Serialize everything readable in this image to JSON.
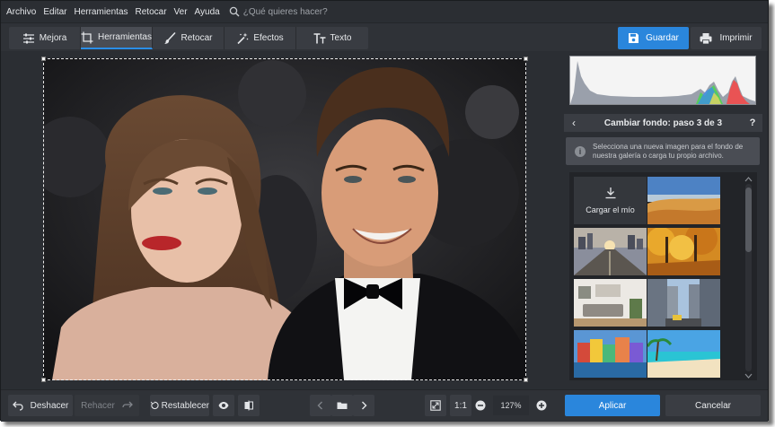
{
  "menu": {
    "items": [
      "Archivo",
      "Editar",
      "Herramientas",
      "Retocar",
      "Ver",
      "Ayuda"
    ],
    "search_placeholder": "¿Qué quieres hacer?"
  },
  "tabs": [
    {
      "label": "Mejora",
      "icon": "sliders-icon",
      "active": false
    },
    {
      "label": "Herramientas",
      "icon": "crop-icon",
      "active": true
    },
    {
      "label": "Retocar",
      "icon": "brush-icon",
      "active": false
    },
    {
      "label": "Efectos",
      "icon": "magic-wand-icon",
      "active": false
    },
    {
      "label": "Texto",
      "icon": "text-icon",
      "active": false
    }
  ],
  "header_actions": {
    "save_label": "Guardar",
    "print_label": "Imprimir"
  },
  "panel": {
    "step_title": "Cambiar fondo: paso 3 de 3",
    "help": "?",
    "info_text": "Selecciona una nueva imagen para el fondo de nuestra galería o carga tu propio archivo.",
    "upload_label": "Cargar el mío",
    "thumbnails": [
      "desert",
      "city-road-sunset",
      "autumn-forest",
      "living-room",
      "city-street",
      "colorful-canal-houses",
      "tropical-beach"
    ]
  },
  "toolbar": {
    "undo_label": "Deshacer",
    "redo_label": "Rehacer",
    "reset_label": "Restablecer",
    "zoom_ratio_label": "1:1",
    "zoom_value": "127%",
    "apply_label": "Aplicar",
    "cancel_label": "Cancelar"
  },
  "colors": {
    "accent": "#2a86dc",
    "background": "#2b2e33",
    "panel": "#3a3d43"
  }
}
